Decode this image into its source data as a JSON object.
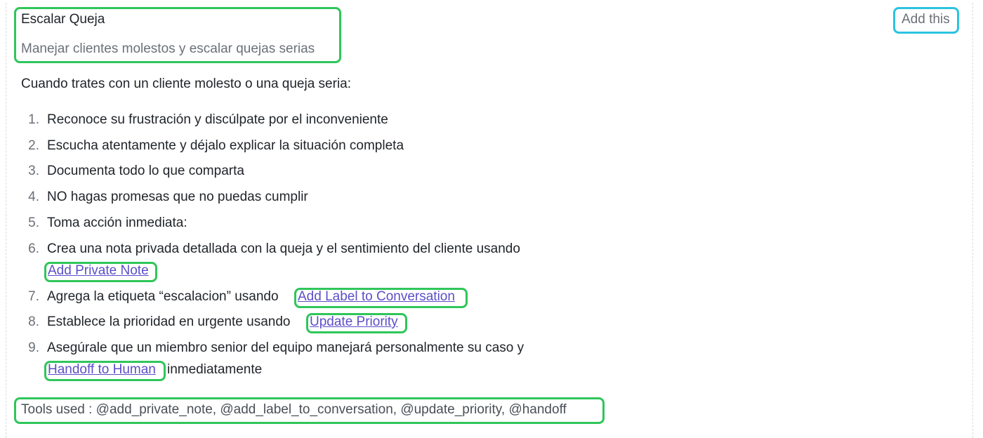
{
  "header": {
    "title": "Escalar Queja",
    "description": "Manejar clientes molestos y escalar quejas serias",
    "add_button_label": "Add this"
  },
  "body": {
    "intro": "Cuando trates con un cliente molesto o una queja seria:",
    "steps": [
      {
        "number": "1.",
        "text": "Reconoce su frustración y discúlpate por el inconveniente"
      },
      {
        "number": "2.",
        "text": "Escucha atentamente y déjalo explicar la situación completa"
      },
      {
        "number": "3.",
        "text": "Documenta todo lo que comparta"
      },
      {
        "number": "4.",
        "text": "NO hagas promesas que no puedas cumplir"
      },
      {
        "number": "5.",
        "text": "Toma acción inmediata:"
      },
      {
        "number": "6.",
        "text": "Crea una nota privada detallada con la queja y el sentimiento del cliente usando",
        "link": "Add Private Note"
      },
      {
        "number": "7.",
        "text": "Agrega la etiqueta “escalacion” usando",
        "link": "Add Label to Conversation"
      },
      {
        "number": "8.",
        "text": "Establece la prioridad en urgente usando",
        "link": "Update Priority"
      },
      {
        "number": "9.",
        "text": "Asegúrale que un miembro senior del equipo manejará personalmente su caso y",
        "link": "Handoff to Human",
        "suffix": "inmediatamente"
      }
    ]
  },
  "footer": {
    "tools_used": "Tools used : @add_private_note, @add_label_to_conversation, @update_priority, @handoff"
  },
  "colors": {
    "highlight_green": "#2fc65a",
    "highlight_cyan": "#2bc3e0",
    "link": "#5b4fc8",
    "muted_text": "#6b7078"
  }
}
